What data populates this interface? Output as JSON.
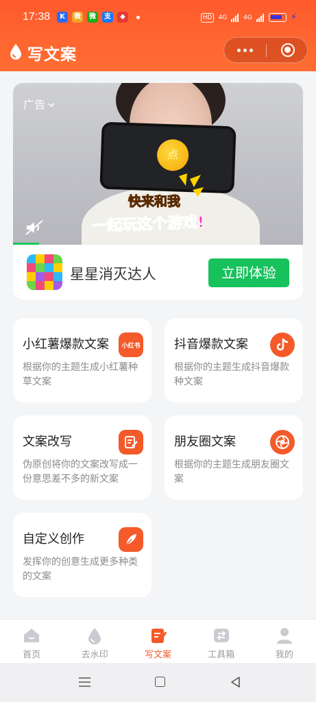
{
  "status_bar": {
    "time": "17:38",
    "apps": [
      {
        "icon": "k-app-icon",
        "glyph": "K",
        "color": "#2b6cf6"
      },
      {
        "icon": "weibo-icon",
        "glyph": "微",
        "color": "#f5a623"
      },
      {
        "icon": "wechat-icon",
        "glyph": "微",
        "color": "#1aad19"
      },
      {
        "icon": "alipay-icon",
        "glyph": "支",
        "color": "#1677ff"
      },
      {
        "icon": "map-icon",
        "glyph": "◆",
        "color": "#e53935"
      }
    ],
    "hd_label": "HD",
    "net1": "4G",
    "net2": "4G"
  },
  "header": {
    "title": "写文案",
    "accent_color": "#ff5a2c"
  },
  "ad": {
    "label": "广告",
    "video_text_1": "快来和我",
    "video_text_2": "一起玩这个游戏!",
    "coin_glyph": "点",
    "progress": 0.09,
    "game_name": "星星消灭达人",
    "cta_label": "立即体验",
    "cta_color": "#17c15c"
  },
  "cards": [
    {
      "title": "小红薯爆款文案",
      "desc": "根据你的主题生成小红薯种草文案",
      "icon": "xiaohongshu-icon",
      "icon_text": "小红书"
    },
    {
      "title": "抖音爆款文案",
      "desc": "根据你的主题生成抖音爆款种文案",
      "icon": "douyin-icon",
      "icon_text": ""
    },
    {
      "title": "文案改写",
      "desc": "伪原创将你的文案改写成一份意思差不多的新文案",
      "icon": "edit-note-icon",
      "icon_text": ""
    },
    {
      "title": "朋友圈文案",
      "desc": "根据你的主题生成朋友圈文案",
      "icon": "camera-shutter-icon",
      "icon_text": ""
    },
    {
      "title": "自定义创作",
      "desc": "发挥你的创意生成更多种类的文案",
      "icon": "feather-icon",
      "icon_text": ""
    }
  ],
  "tabs": [
    {
      "label": "首页",
      "icon": "home-icon",
      "active": false
    },
    {
      "label": "去水印",
      "icon": "water-drop-icon",
      "active": false
    },
    {
      "label": "写文案",
      "icon": "write-copy-icon",
      "active": true
    },
    {
      "label": "工具箱",
      "icon": "toolbox-icon",
      "active": false
    },
    {
      "label": "我的",
      "icon": "profile-icon",
      "active": false
    }
  ]
}
